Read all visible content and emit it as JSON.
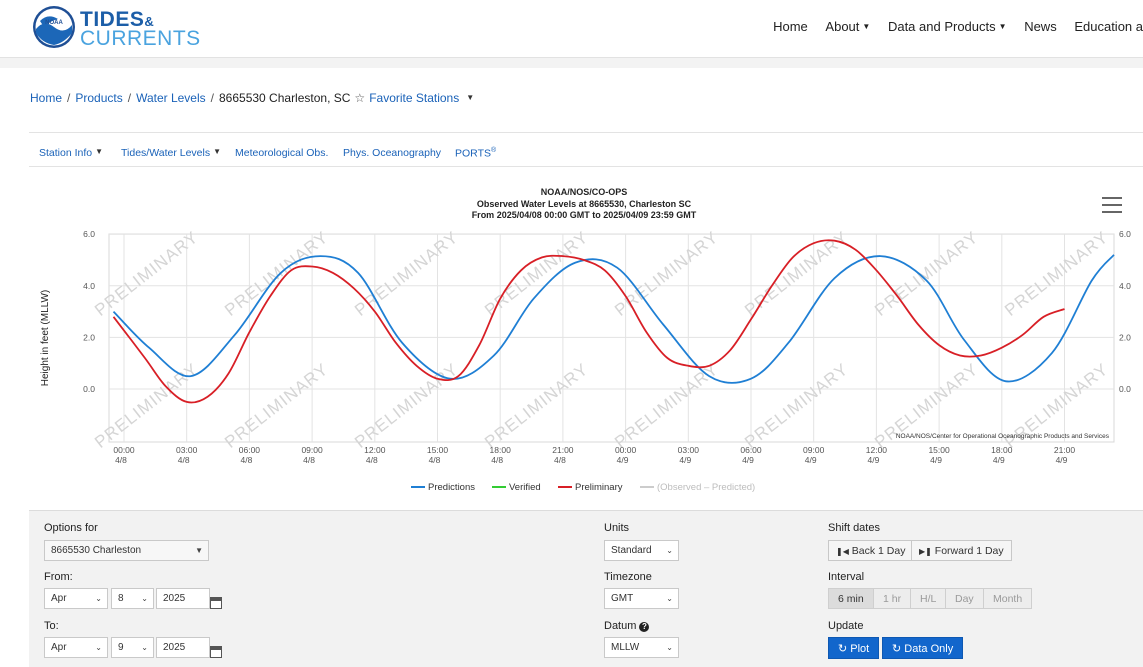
{
  "header": {
    "brand_line1": "TIDES",
    "brand_amp": "&",
    "brand_line2": "CURRENTS",
    "logo_text": "NOAA",
    "nav": [
      "Home",
      "About",
      "Data and Products",
      "News",
      "Education a"
    ]
  },
  "breadcrumb": {
    "items": [
      "Home",
      "Products",
      "Water Levels"
    ],
    "current": "8665530 Charleston, SC",
    "favorite": "Favorite Stations"
  },
  "subnav": [
    "Station Info",
    "Tides/Water Levels",
    "Meteorological Obs.",
    "Phys. Oceanography",
    "PORTS"
  ],
  "chart_meta": {
    "title1": "NOAA/NOS/CO-OPS",
    "title2": "Observed Water Levels at 8665530, Charleston SC",
    "title3": "From 2025/04/08 00:00 GMT to 2025/04/09 23:59 GMT",
    "ylabel": "Height in feet (MLLW)",
    "watermark": "PRELIMINARY",
    "credit": "NOAA/NOS/Center for Operational Oceanographic Products and Services",
    "legend": [
      "Predictions",
      "Verified",
      "Preliminary",
      "(Observed – Predicted)"
    ]
  },
  "chart_data": {
    "type": "line",
    "title": "NOAA/NOS/CO-OPS Observed Water Levels at 8665530, Charleston SC",
    "ylabel": "Height in feet (MLLW)",
    "xlabel": "",
    "ylim": [
      -2,
      6
    ],
    "yticks": [
      0.0,
      2.0,
      4.0,
      6.0
    ],
    "xticks": [
      {
        "time": "00:00",
        "date": "4/8"
      },
      {
        "time": "03:00",
        "date": "4/8"
      },
      {
        "time": "06:00",
        "date": "4/8"
      },
      {
        "time": "09:00",
        "date": "4/8"
      },
      {
        "time": "12:00",
        "date": "4/8"
      },
      {
        "time": "15:00",
        "date": "4/8"
      },
      {
        "time": "18:00",
        "date": "4/8"
      },
      {
        "time": "21:00",
        "date": "4/8"
      },
      {
        "time": "00:00",
        "date": "4/9"
      },
      {
        "time": "03:00",
        "date": "4/9"
      },
      {
        "time": "06:00",
        "date": "4/9"
      },
      {
        "time": "09:00",
        "date": "4/9"
      },
      {
        "time": "12:00",
        "date": "4/9"
      },
      {
        "time": "15:00",
        "date": "4/9"
      },
      {
        "time": "18:00",
        "date": "4/9"
      },
      {
        "time": "21:00",
        "date": "4/9"
      }
    ],
    "xlim_hours": [
      0,
      48
    ],
    "grid": true,
    "legend_position": "bottom",
    "series": [
      {
        "name": "Predictions",
        "color": "#1f7fd4",
        "x_hours": [
          -0.5,
          1.2,
          3.2,
          5.3,
          7.5,
          9.4,
          11.2,
          13.3,
          15.6,
          17.7,
          19.6,
          21.6,
          23.6,
          25.8,
          28.0,
          30.0,
          31.8,
          34.0,
          36.2,
          38.4,
          40.2,
          42.2,
          44.4,
          46.3,
          47.5
        ],
        "y_ft": [
          3.0,
          1.6,
          0.5,
          2.1,
          4.5,
          5.15,
          4.5,
          1.8,
          0.4,
          1.3,
          3.5,
          4.9,
          4.7,
          2.5,
          0.5,
          0.4,
          1.8,
          4.3,
          5.15,
          4.2,
          1.9,
          0.3,
          1.4,
          4.2,
          5.2
        ]
      },
      {
        "name": "Preliminary",
        "color": "#d81f26",
        "x_hours": [
          -0.5,
          1.0,
          2.0,
          3.0,
          4.0,
          5.0,
          6.0,
          7.0,
          8.0,
          9.0,
          10.0,
          11.0,
          12.0,
          13.0,
          14.0,
          15.0,
          16.0,
          17.0,
          18.0,
          19.0,
          20.0,
          21.0,
          22.0,
          23.0,
          24.0,
          25.0,
          26.0,
          27.0,
          28.0,
          29.0,
          30.0,
          31.0,
          32.0,
          33.0,
          34.0,
          35.0,
          36.0,
          37.0,
          38.0,
          39.0,
          40.0,
          41.0,
          42.0,
          43.0,
          44.0,
          45.0
        ],
        "y_ft": [
          2.8,
          1.2,
          0.1,
          -0.5,
          -0.3,
          0.6,
          2.2,
          3.6,
          4.6,
          4.75,
          4.5,
          3.9,
          3.0,
          1.8,
          0.9,
          0.4,
          0.5,
          1.7,
          3.5,
          4.6,
          5.1,
          5.15,
          5.0,
          4.6,
          3.6,
          2.2,
          1.2,
          0.9,
          0.9,
          1.5,
          2.7,
          4.0,
          5.1,
          5.65,
          5.75,
          5.4,
          4.6,
          3.6,
          2.5,
          1.7,
          1.3,
          1.3,
          1.6,
          2.1,
          2.8,
          3.1
        ]
      }
    ]
  },
  "options": {
    "options_for_label": "Options for",
    "station": "8665530 Charleston",
    "from_label": "From:",
    "to_label": "To:",
    "from": {
      "month": "Apr",
      "day": "8",
      "year": "2025"
    },
    "to": {
      "month": "Apr",
      "day": "9",
      "year": "2025"
    },
    "units_label": "Units",
    "units": "Standard",
    "timezone_label": "Timezone",
    "timezone": "GMT",
    "datum_label": "Datum",
    "datum": "MLLW",
    "shift_label": "Shift dates",
    "back": "Back 1 Day",
    "forward": "Forward 1 Day",
    "interval_label": "Interval",
    "intervals": [
      "6 min",
      "1 hr",
      "H/L",
      "Day",
      "Month"
    ],
    "update_label": "Update",
    "plot": "Plot",
    "data_only": "Data Only"
  },
  "colors": {
    "brand_dark": "#1c5ea8",
    "brand_light": "#4aa3df",
    "link": "#1a62b8",
    "button": "#1266cc",
    "verified": "#33cc33"
  }
}
